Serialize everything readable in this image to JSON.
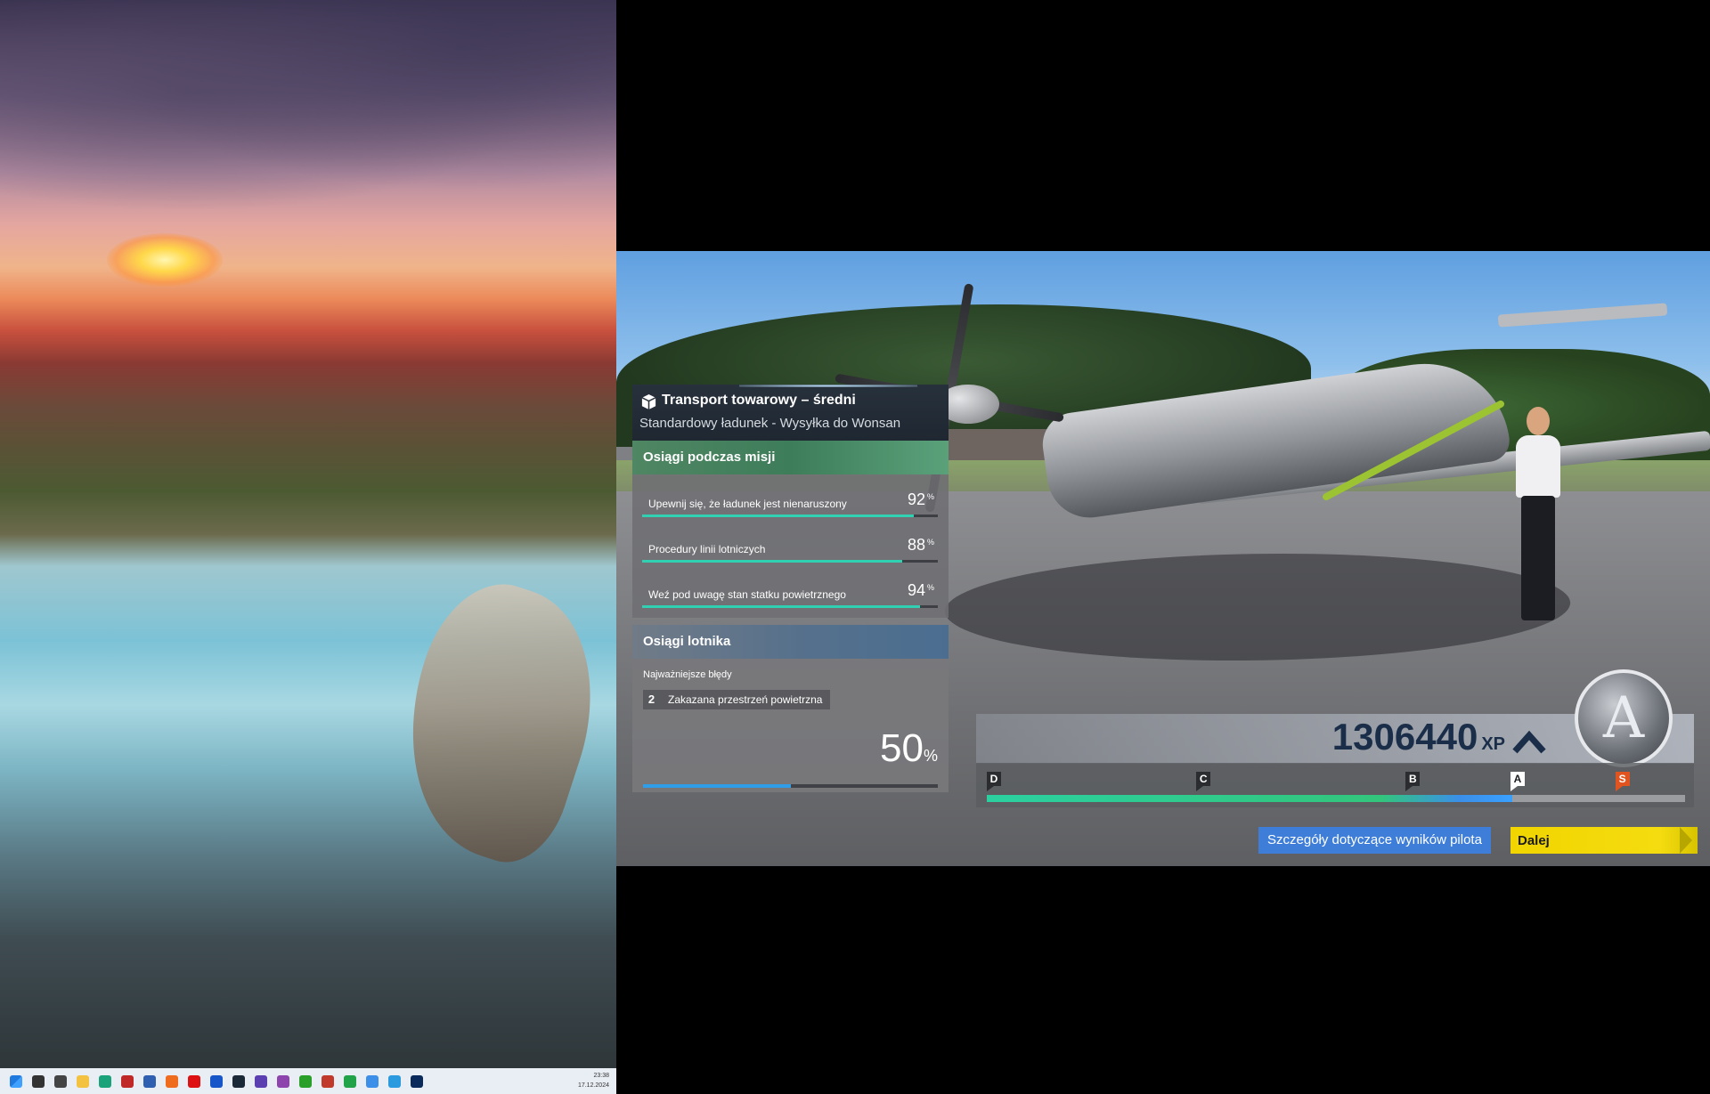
{
  "taskbar": {
    "icons": [
      "start-icon",
      "search-icon",
      "task-view-icon",
      "file-explorer-icon",
      "edge-icon",
      "rad-icon",
      "app-icon",
      "firefox-icon",
      "netflix-icon",
      "disney-icon",
      "steam-icon",
      "app-icon",
      "app-icon",
      "app-icon",
      "app-icon",
      "xbox-icon",
      "photos-icon",
      "app-icon",
      "flight-simulator-icon"
    ],
    "time": "23:38",
    "date": "17.12.2024"
  },
  "mission": {
    "title": "Transport towarowy – średni",
    "subtitle": "Standardowy ładunek - Wysyłka do Wonsan"
  },
  "performance": {
    "heading": "Osiągi podczas misji",
    "unit": "%",
    "stats": [
      {
        "label": "Upewnij się, że ładunek jest nienaruszony",
        "value": "92",
        "fraction": 0.92
      },
      {
        "label": "Procedury linii lotniczych",
        "value": "88",
        "fraction": 0.88
      },
      {
        "label": "Weź pod uwagę stan statku powietrznego",
        "value": "94",
        "fraction": 0.94
      }
    ]
  },
  "pilot_performance": {
    "heading": "Osiągi lotnika",
    "errors_label": "Najważniejsze błędy",
    "error_count": "2",
    "error_text": "Zakazana przestrzeń powietrzna",
    "value": "50",
    "unit": "%",
    "fraction": 0.5
  },
  "xp": {
    "value": "1306440",
    "unit": "XP"
  },
  "rank": {
    "badge_letter": "A",
    "progress_fraction": 0.753,
    "marks": [
      {
        "letter": "D",
        "position": 0.0
      },
      {
        "letter": "C",
        "position": 0.3
      },
      {
        "letter": "B",
        "position": 0.6
      },
      {
        "letter": "A",
        "position": 0.75
      },
      {
        "letter": "S",
        "position": 0.9
      }
    ]
  },
  "buttons": {
    "details": "Szczegóły dotyczące wyników pilota",
    "next": "Dalej"
  },
  "colors": {
    "accent_teal": "#2fd1b2",
    "accent_blue": "#3e7ed8",
    "next_yellow": "#f2d500",
    "rank_s": "#e2541f"
  }
}
